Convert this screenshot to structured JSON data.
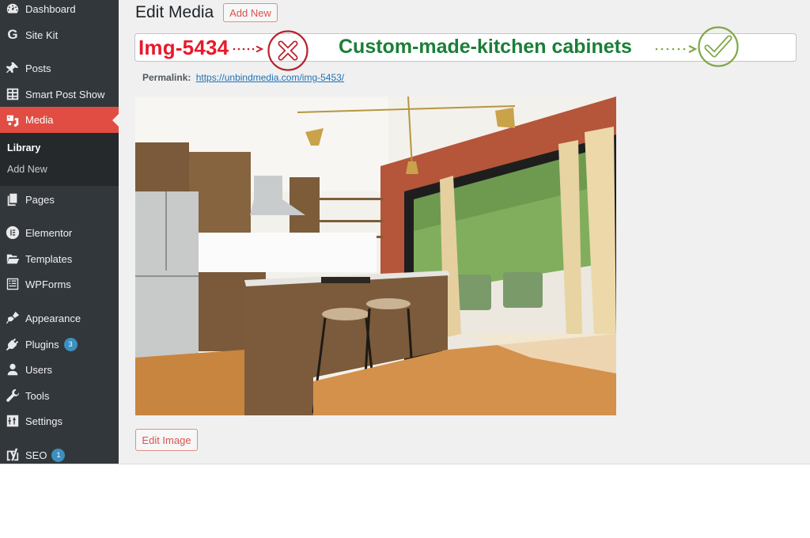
{
  "sidebar": {
    "items": [
      {
        "label": "Dashboard",
        "icon": "dashboard-icon"
      },
      {
        "label": "Site Kit",
        "icon": "google-g-icon"
      },
      {
        "label": "Posts",
        "icon": "pushpin-icon"
      },
      {
        "label": "Smart Post Show",
        "icon": "grid-table-icon"
      },
      {
        "label": "Media",
        "icon": "media-icon",
        "active": true
      },
      {
        "label": "Pages",
        "icon": "pages-icon"
      },
      {
        "label": "Elementor",
        "icon": "elementor-icon"
      },
      {
        "label": "Templates",
        "icon": "folder-open-icon"
      },
      {
        "label": "WPForms",
        "icon": "form-icon"
      },
      {
        "label": "Appearance",
        "icon": "paintbrush-icon"
      },
      {
        "label": "Plugins",
        "icon": "plug-icon",
        "badge": "3"
      },
      {
        "label": "Users",
        "icon": "user-icon"
      },
      {
        "label": "Tools",
        "icon": "wrench-icon"
      },
      {
        "label": "Settings",
        "icon": "sliders-icon"
      },
      {
        "label": "SEO",
        "icon": "yoast-icon",
        "badge": "1"
      }
    ],
    "submenu": [
      {
        "label": "Library",
        "current": true
      },
      {
        "label": "Add New"
      }
    ]
  },
  "header": {
    "title": "Edit Media",
    "add_new_label": "Add New"
  },
  "title_field": {
    "old_name": "Img-5434",
    "new_name": "Custom-made-kitchen cabinets",
    "wrong_icon": "x-circle-icon",
    "right_icon": "check-circle-icon"
  },
  "permalink": {
    "label": "Permalink:",
    "url": "https://unbindmedia.com/img-5453/"
  },
  "image": {
    "alt": "Kitchen with rustic wood cabinets, island with bar stools, brick wall and large windows"
  },
  "edit_image_label": "Edit Image",
  "colors": {
    "sidebar_bg": "#32373c",
    "active_accent": "#e14d43",
    "badge": "#3c8fbf",
    "wrong_red": "#e8192c",
    "right_green": "#1a7f37",
    "check_olive": "#7fa845",
    "x_darkred": "#b5242b",
    "link": "#2271b1"
  }
}
